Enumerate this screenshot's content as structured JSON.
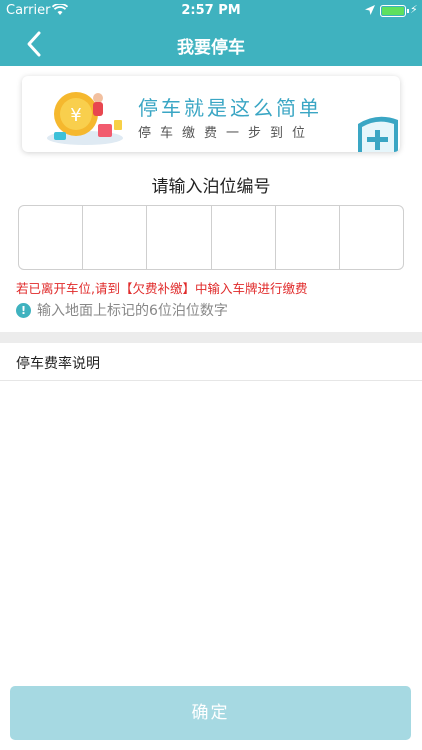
{
  "status_bar": {
    "carrier": "Carrier",
    "time": "2:57 PM"
  },
  "nav": {
    "title": "我要停车"
  },
  "banner": {
    "headline": "停车就是这么简单",
    "subline": "停车缴费一步到位"
  },
  "berth": {
    "title": "请输入泊位编号",
    "box_count": 6,
    "warning": "若已离开车位,请到【欠费补缴】中输入车牌进行缴费",
    "hint": "输入地面上标记的6位泊位数字"
  },
  "rates": {
    "label": "停车费率说明"
  },
  "confirm": {
    "label": "确定"
  },
  "colors": {
    "brand": "#3fb2bf",
    "warning": "#e02a2a",
    "button_disabled": "#a6d9e2",
    "banner_text": "#3aa6c4"
  },
  "icons": [
    "wifi-icon",
    "location-arrow-icon",
    "battery-icon",
    "back-chevron-icon",
    "coin-illustration-icon",
    "shield-plus-icon",
    "info-icon"
  ]
}
